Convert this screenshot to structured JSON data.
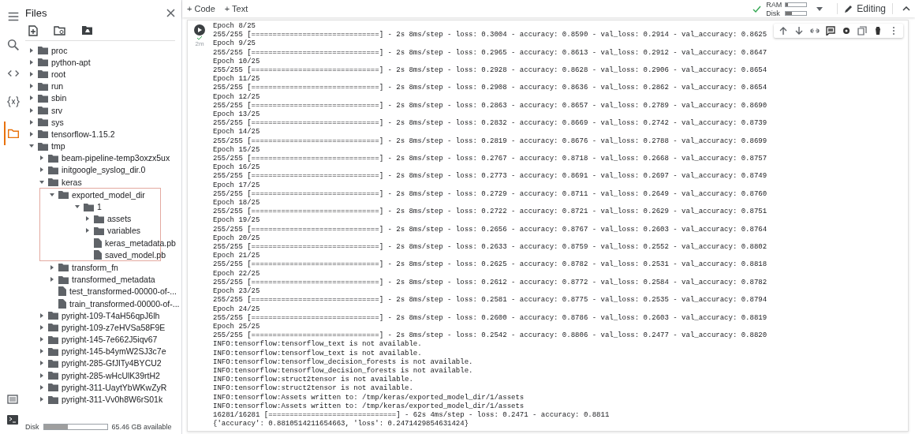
{
  "sidebar": {
    "title": "Files",
    "rail": [
      {
        "kind": "menu",
        "selected": false
      },
      {
        "kind": "search",
        "selected": false
      },
      {
        "kind": "code",
        "selected": false
      },
      {
        "kind": "variables",
        "selected": false
      },
      {
        "kind": "folder",
        "selected": true
      }
    ],
    "tree": [
      {
        "kind": "folder",
        "name": "proc",
        "expanded": false
      },
      {
        "kind": "folder",
        "name": "python-apt",
        "expanded": false
      },
      {
        "kind": "folder",
        "name": "root",
        "expanded": false
      },
      {
        "kind": "folder",
        "name": "run",
        "expanded": false
      },
      {
        "kind": "folder",
        "name": "sbin",
        "expanded": false
      },
      {
        "kind": "folder",
        "name": "srv",
        "expanded": false
      },
      {
        "kind": "folder",
        "name": "sys",
        "expanded": false
      },
      {
        "kind": "folder",
        "name": "tensorflow-1.15.2",
        "expanded": false
      },
      {
        "kind": "folder",
        "name": "tmp",
        "expanded": true,
        "children": [
          {
            "kind": "folder",
            "name": "beam-pipeline-temp3oxzx5ux",
            "expanded": false
          },
          {
            "kind": "folder",
            "name": "initgoogle_syslog_dir.0",
            "expanded": false
          },
          {
            "kind": "folder",
            "name": "keras",
            "expanded": true,
            "children": [
              {
                "kind": "folder",
                "name": "exported_model_dir",
                "expanded": true,
                "highlighted": true,
                "children": [
                  {
                    "kind": "folder",
                    "name": "1",
                    "expanded": true,
                    "children": [
                      {
                        "kind": "folder",
                        "name": "assets",
                        "expanded": false
                      },
                      {
                        "kind": "folder",
                        "name": "variables",
                        "expanded": false
                      },
                      {
                        "kind": "file",
                        "name": "keras_metadata.pb"
                      },
                      {
                        "kind": "file",
                        "name": "saved_model.pb"
                      }
                    ]
                  }
                ]
              },
              {
                "kind": "folder",
                "name": "transform_fn",
                "expanded": false
              },
              {
                "kind": "folder",
                "name": "transformed_metadata",
                "expanded": false
              },
              {
                "kind": "file",
                "name": "test_transformed-00000-of-..."
              },
              {
                "kind": "file",
                "name": "train_transformed-00000-of-..."
              }
            ]
          },
          {
            "kind": "folder",
            "name": "pyright-109-T4aH56qpJ6lh",
            "expanded": false
          },
          {
            "kind": "folder",
            "name": "pyright-109-z7eHVSa58F9E",
            "expanded": false
          },
          {
            "kind": "folder",
            "name": "pyright-145-7e662J5iqv67",
            "expanded": false
          },
          {
            "kind": "folder",
            "name": "pyright-145-b4ymW2SJ3c7e",
            "expanded": false
          },
          {
            "kind": "folder",
            "name": "pyright-285-GfJlTy4BYCU2",
            "expanded": false
          },
          {
            "kind": "folder",
            "name": "pyright-285-wHcUlK39rtH2",
            "expanded": false
          },
          {
            "kind": "folder",
            "name": "pyright-311-UaytYbWKwZyR",
            "expanded": false
          },
          {
            "kind": "folder",
            "name": "pyright-311-Vv0h8W6rS01k",
            "expanded": false
          }
        ]
      }
    ],
    "disk": {
      "label": "Disk",
      "level": 0.38,
      "reading": "65.46 GB available"
    }
  },
  "toolbar": {
    "add_code": "+ Code",
    "add_text": "+ Text",
    "ram": {
      "label": "RAM",
      "level": 0.1
    },
    "disk": {
      "label": "Disk",
      "level": 0.3
    },
    "mode": "Editing"
  },
  "cell": {
    "exec_time": "2m",
    "output": [
      "Epoch 8/25",
      "255/255 [==============================] - 2s 8ms/step - loss: 0.3004 - accuracy: 0.8590 - val_loss: 0.2914 - val_accuracy: 0.8625",
      "Epoch 9/25",
      "255/255 [==============================] - 2s 8ms/step - loss: 0.2965 - accuracy: 0.8613 - val_loss: 0.2912 - val_accuracy: 0.8647",
      "Epoch 10/25",
      "255/255 [==============================] - 2s 8ms/step - loss: 0.2928 - accuracy: 0.8628 - val_loss: 0.2906 - val_accuracy: 0.8654",
      "Epoch 11/25",
      "255/255 [==============================] - 2s 8ms/step - loss: 0.2908 - accuracy: 0.8636 - val_loss: 0.2862 - val_accuracy: 0.8654",
      "Epoch 12/25",
      "255/255 [==============================] - 2s 8ms/step - loss: 0.2863 - accuracy: 0.8657 - val_loss: 0.2789 - val_accuracy: 0.8690",
      "Epoch 13/25",
      "255/255 [==============================] - 2s 8ms/step - loss: 0.2832 - accuracy: 0.8669 - val_loss: 0.2742 - val_accuracy: 0.8739",
      "Epoch 14/25",
      "255/255 [==============================] - 2s 8ms/step - loss: 0.2819 - accuracy: 0.8676 - val_loss: 0.2788 - val_accuracy: 0.8699",
      "Epoch 15/25",
      "255/255 [==============================] - 2s 8ms/step - loss: 0.2767 - accuracy: 0.8718 - val_loss: 0.2668 - val_accuracy: 0.8757",
      "Epoch 16/25",
      "255/255 [==============================] - 2s 8ms/step - loss: 0.2773 - accuracy: 0.8691 - val_loss: 0.2697 - val_accuracy: 0.8749",
      "Epoch 17/25",
      "255/255 [==============================] - 2s 8ms/step - loss: 0.2729 - accuracy: 0.8711 - val_loss: 0.2649 - val_accuracy: 0.8760",
      "Epoch 18/25",
      "255/255 [==============================] - 2s 8ms/step - loss: 0.2722 - accuracy: 0.8721 - val_loss: 0.2629 - val_accuracy: 0.8751",
      "Epoch 19/25",
      "255/255 [==============================] - 2s 8ms/step - loss: 0.2656 - accuracy: 0.8767 - val_loss: 0.2603 - val_accuracy: 0.8764",
      "Epoch 20/25",
      "255/255 [==============================] - 2s 8ms/step - loss: 0.2633 - accuracy: 0.8759 - val_loss: 0.2552 - val_accuracy: 0.8802",
      "Epoch 21/25",
      "255/255 [==============================] - 2s 8ms/step - loss: 0.2625 - accuracy: 0.8782 - val_loss: 0.2531 - val_accuracy: 0.8818",
      "Epoch 22/25",
      "255/255 [==============================] - 2s 8ms/step - loss: 0.2612 - accuracy: 0.8772 - val_loss: 0.2584 - val_accuracy: 0.8782",
      "Epoch 23/25",
      "255/255 [==============================] - 2s 8ms/step - loss: 0.2581 - accuracy: 0.8775 - val_loss: 0.2535 - val_accuracy: 0.8794",
      "Epoch 24/25",
      "255/255 [==============================] - 2s 8ms/step - loss: 0.2600 - accuracy: 0.8786 - val_loss: 0.2603 - val_accuracy: 0.8819",
      "Epoch 25/25",
      "255/255 [==============================] - 2s 8ms/step - loss: 0.2542 - accuracy: 0.8806 - val_loss: 0.2477 - val_accuracy: 0.8820",
      "INFO:tensorflow:tensorflow_text is not available.",
      "INFO:tensorflow:tensorflow_text is not available.",
      "INFO:tensorflow:tensorflow_decision_forests is not available.",
      "INFO:tensorflow:tensorflow_decision_forests is not available.",
      "INFO:tensorflow:struct2tensor is not available.",
      "INFO:tensorflow:struct2tensor is not available.",
      "INFO:tensorflow:Assets written to: /tmp/keras/exported_model_dir/1/assets",
      "INFO:tensorflow:Assets written to: /tmp/keras/exported_model_dir/1/assets",
      "16281/16281 [==============================] - 62s 4ms/step - loss: 0.2471 - accuracy: 0.8811",
      "{'accuracy': 0.8810514211654663, 'loss': 0.2471429854631424}"
    ]
  }
}
